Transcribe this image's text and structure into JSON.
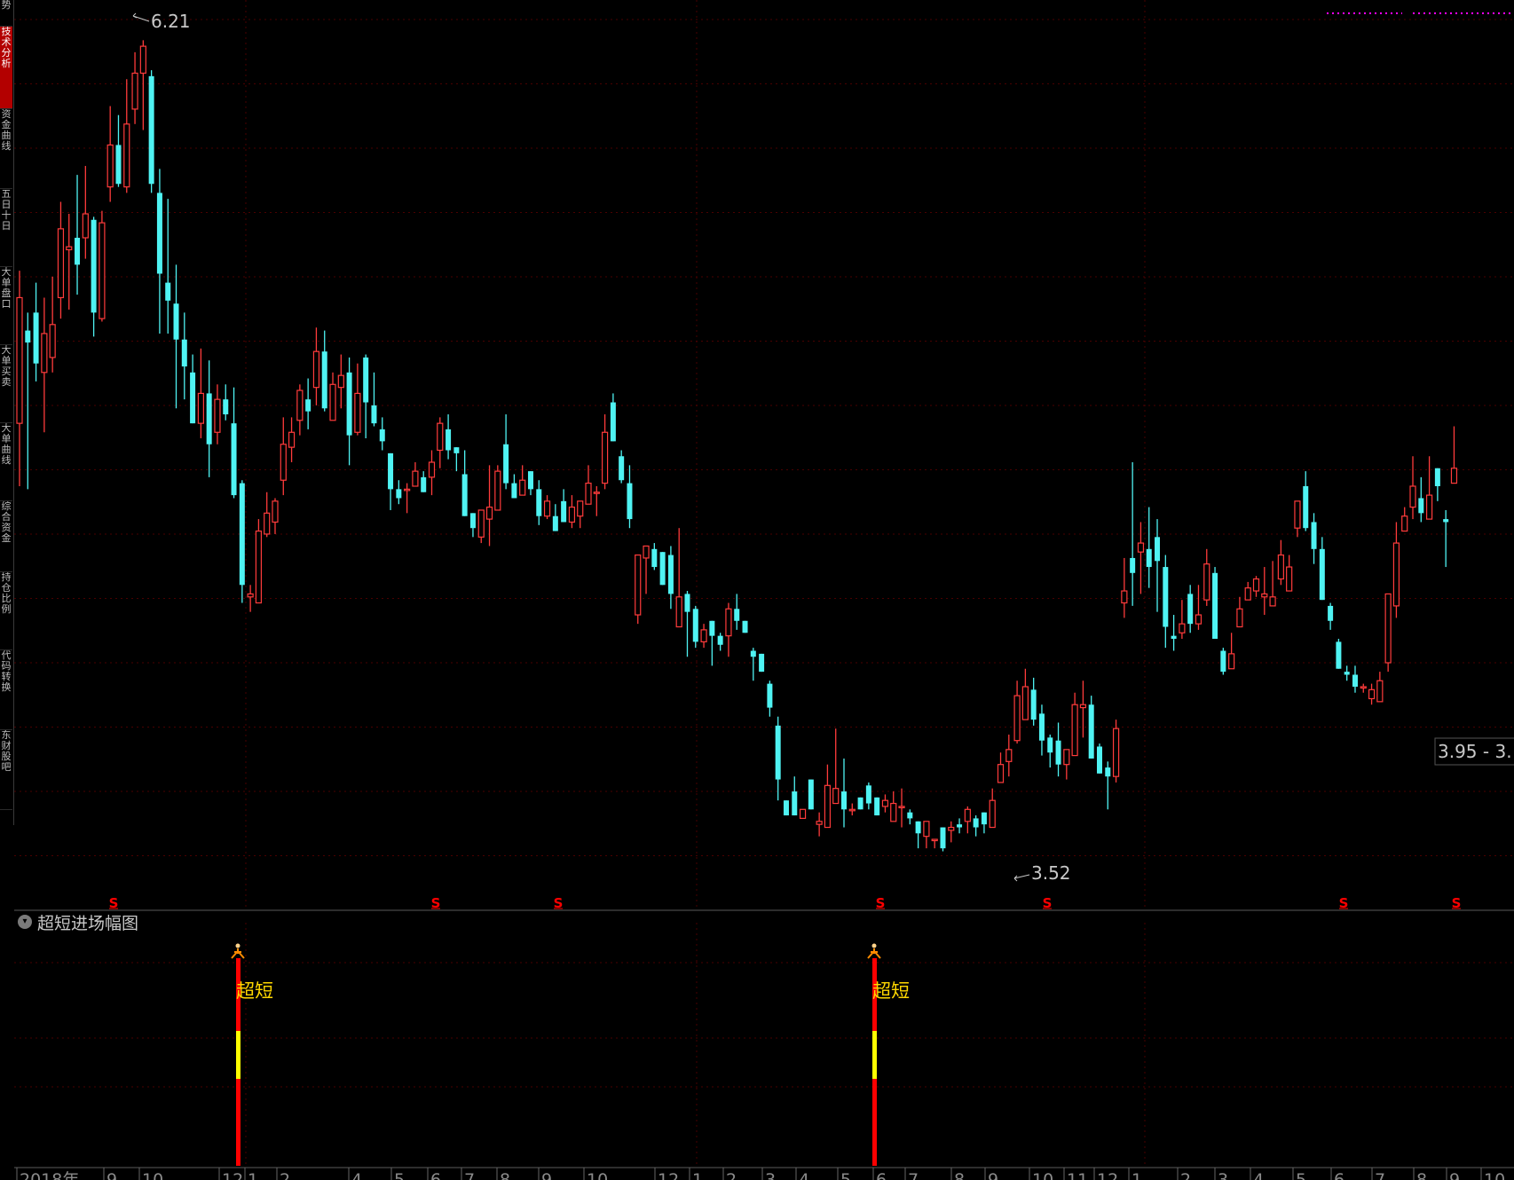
{
  "sidebar": {
    "tabs": [
      {
        "label": "势",
        "active": false
      },
      {
        "label": "技术分析",
        "active": true
      },
      {
        "label": "资金曲线",
        "active": false
      },
      {
        "label": "五日十日",
        "active": false
      },
      {
        "label": "大单盘口",
        "active": false
      },
      {
        "label": "大单买卖",
        "active": false
      },
      {
        "label": "大单曲线",
        "active": false
      },
      {
        "label": "综合资金",
        "active": false
      },
      {
        "label": "持仓比例",
        "active": false
      },
      {
        "label": "代码转换",
        "active": false
      },
      {
        "label": "东财股吧",
        "active": false
      }
    ]
  },
  "indicator_panel": {
    "title": "超短进场幅图"
  },
  "colors": {
    "up": "#ff3b3b",
    "down": "#4ff3f3",
    "grid": "#4a0000",
    "separator": "#5a5a5a",
    "signal_text": "#ffd700",
    "signal_bar": "#ff0000",
    "signal_mid": "#ffff00",
    "marker": "#ff0000",
    "magenta": "#ff00ff"
  },
  "chart_data": {
    "type": "candlestick",
    "title": "",
    "xlabel": "",
    "ylabel": "",
    "ylim": [
      3.4,
      6.32
    ],
    "grid": true,
    "x_axis_labels": [
      "2018年",
      "9",
      "10",
      "12",
      "1",
      "2",
      "4",
      "5",
      "6",
      "7",
      "8",
      "9",
      "10",
      "12",
      "1",
      "2",
      "3",
      "4",
      "5",
      "6",
      "7",
      "8",
      "9",
      "10",
      "11",
      "12",
      "1",
      "2",
      "3",
      "4",
      "5",
      "6",
      "7",
      "8",
      "9",
      "10"
    ],
    "candles": [
      [
        4.95,
        5.37,
        5.46,
        4.74
      ],
      [
        5.26,
        5.22,
        5.32,
        4.73
      ],
      [
        5.32,
        5.15,
        5.42,
        5.09
      ],
      [
        5.12,
        5.25,
        5.37,
        4.92
      ],
      [
        5.17,
        5.28,
        5.44,
        5.12
      ],
      [
        5.37,
        5.6,
        5.69,
        5.3
      ],
      [
        5.53,
        5.54,
        5.65,
        5.33
      ],
      [
        5.57,
        5.48,
        5.78,
        5.38
      ],
      [
        5.57,
        5.65,
        5.81,
        5.5
      ],
      [
        5.63,
        5.32,
        5.64,
        5.24
      ],
      [
        5.3,
        5.62,
        5.66,
        5.29
      ],
      [
        5.74,
        5.88,
        6.01,
        5.69
      ],
      [
        5.88,
        5.75,
        5.98,
        5.74
      ],
      [
        5.74,
        5.95,
        6.1,
        5.72
      ],
      [
        6.0,
        6.12,
        6.19,
        5.95
      ],
      [
        6.12,
        6.21,
        6.23,
        5.93
      ],
      [
        6.11,
        5.75,
        6.13,
        5.72
      ],
      [
        5.72,
        5.45,
        5.8,
        5.25
      ],
      [
        5.42,
        5.36,
        5.7,
        5.25
      ],
      [
        5.35,
        5.23,
        5.48,
        5.0
      ],
      [
        5.23,
        5.14,
        5.32,
        5.03
      ],
      [
        5.12,
        4.95,
        5.18,
        4.95
      ],
      [
        4.95,
        5.05,
        5.2,
        4.9
      ],
      [
        5.05,
        4.88,
        5.16,
        4.77
      ],
      [
        4.92,
        5.03,
        5.08,
        4.88
      ],
      [
        5.03,
        4.98,
        5.08,
        4.96
      ],
      [
        4.95,
        4.71,
        5.07,
        4.7
      ],
      [
        4.75,
        4.41,
        4.76,
        4.35
      ],
      [
        4.37,
        4.38,
        4.41,
        4.32
      ],
      [
        4.35,
        4.59,
        4.63,
        4.39
      ],
      [
        4.58,
        4.65,
        4.72,
        4.57
      ],
      [
        4.62,
        4.69,
        4.7,
        4.58
      ],
      [
        4.76,
        4.88,
        4.97,
        4.71
      ],
      [
        4.87,
        4.92,
        4.97,
        4.82
      ],
      [
        4.96,
        5.06,
        5.08,
        4.91
      ],
      [
        5.03,
        4.99,
        5.1,
        4.93
      ],
      [
        5.07,
        5.19,
        5.27,
        5.01
      ],
      [
        5.19,
        5.0,
        5.26,
        4.99
      ],
      [
        4.96,
        5.08,
        5.12,
        5.05
      ],
      [
        5.07,
        5.11,
        5.18,
        5.0
      ],
      [
        5.12,
        4.91,
        5.17,
        4.81
      ],
      [
        4.92,
        5.05,
        5.15,
        4.91
      ],
      [
        5.17,
        5.02,
        5.18,
        4.9
      ],
      [
        5.01,
        4.95,
        5.12,
        4.94
      ],
      [
        4.93,
        4.89,
        4.97,
        4.86
      ],
      [
        4.85,
        4.73,
        4.83,
        4.66
      ],
      [
        4.73,
        4.7,
        4.76,
        4.68
      ],
      [
        4.73,
        4.73,
        4.75,
        4.65
      ],
      [
        4.74,
        4.79,
        4.82,
        4.76
      ],
      [
        4.77,
        4.72,
        4.79,
        4.73
      ],
      [
        4.77,
        4.82,
        4.86,
        4.71
      ],
      [
        4.86,
        4.95,
        4.97,
        4.8
      ],
      [
        4.93,
        4.86,
        4.98,
        4.83
      ],
      [
        4.87,
        4.85,
        4.83,
        4.79
      ],
      [
        4.78,
        4.64,
        4.86,
        4.77
      ],
      [
        4.65,
        4.6,
        4.6,
        4.57
      ],
      [
        4.57,
        4.66,
        4.65,
        4.55
      ],
      [
        4.63,
        4.67,
        4.81,
        4.54
      ],
      [
        4.66,
        4.79,
        4.81,
        4.77
      ],
      [
        4.88,
        4.75,
        4.98,
        4.73
      ],
      [
        4.75,
        4.7,
        4.78,
        4.7
      ],
      [
        4.71,
        4.76,
        4.81,
        4.75
      ],
      [
        4.79,
        4.73,
        4.79,
        4.71
      ],
      [
        4.73,
        4.64,
        4.76,
        4.61
      ],
      [
        4.64,
        4.69,
        4.71,
        4.63
      ],
      [
        4.64,
        4.59,
        4.68,
        4.61
      ],
      [
        4.69,
        4.62,
        4.73,
        4.67
      ],
      [
        4.62,
        4.67,
        4.71,
        4.6
      ],
      [
        4.64,
        4.69,
        4.69,
        4.6
      ],
      [
        4.68,
        4.75,
        4.81,
        4.74
      ],
      [
        4.72,
        4.72,
        4.74,
        4.64
      ],
      [
        4.75,
        4.92,
        4.98,
        4.73
      ],
      [
        5.02,
        4.89,
        5.05,
        4.96
      ],
      [
        4.84,
        4.76,
        4.86,
        4.75
      ],
      [
        4.75,
        4.63,
        4.81,
        4.6
      ],
      [
        4.31,
        4.51,
        4.51,
        4.28
      ],
      [
        4.5,
        4.54,
        4.52,
        4.38
      ],
      [
        4.53,
        4.47,
        4.55,
        4.46
      ],
      [
        4.52,
        4.41,
        4.52,
        4.43
      ],
      [
        4.51,
        4.38,
        4.54,
        4.33
      ],
      [
        4.27,
        4.37,
        4.6,
        4.33
      ],
      [
        4.38,
        4.32,
        4.39,
        4.17
      ],
      [
        4.33,
        4.22,
        4.34,
        4.2
      ],
      [
        4.22,
        4.26,
        4.28,
        4.2
      ],
      [
        4.29,
        4.24,
        4.27,
        4.14
      ],
      [
        4.24,
        4.21,
        4.25,
        4.19
      ],
      [
        4.24,
        4.33,
        4.35,
        4.17
      ],
      [
        4.33,
        4.29,
        4.38,
        4.26
      ],
      [
        4.29,
        4.25,
        4.29,
        4.25
      ],
      [
        4.19,
        4.17,
        4.2,
        4.09
      ],
      [
        4.18,
        4.12,
        4.16,
        4.15
      ],
      [
        4.08,
        4.0,
        4.09,
        3.97
      ],
      [
        3.94,
        3.76,
        3.97,
        3.69
      ],
      [
        3.69,
        3.64,
        3.69,
        3.66
      ],
      [
        3.72,
        3.64,
        3.77,
        3.65
      ],
      [
        3.63,
        3.66,
        3.66,
        3.64
      ],
      [
        3.76,
        3.66,
        3.71,
        3.67
      ],
      [
        3.61,
        3.62,
        3.65,
        3.57
      ],
      [
        3.6,
        3.74,
        3.81,
        3.6
      ],
      [
        3.68,
        3.73,
        3.93,
        3.69
      ],
      [
        3.72,
        3.66,
        3.83,
        3.6
      ],
      [
        3.66,
        3.66,
        3.68,
        3.64
      ],
      [
        3.7,
        3.66,
        3.67,
        3.7
      ],
      [
        3.74,
        3.68,
        3.75,
        3.66
      ],
      [
        3.7,
        3.64,
        3.7,
        3.66
      ],
      [
        3.67,
        3.69,
        3.71,
        3.65
      ],
      [
        3.62,
        3.68,
        3.72,
        3.64
      ],
      [
        3.67,
        3.67,
        3.73,
        3.6
      ],
      [
        3.65,
        3.63,
        3.66,
        3.61
      ],
      [
        3.62,
        3.58,
        3.62,
        3.53
      ],
      [
        3.57,
        3.62,
        3.61,
        3.53
      ],
      [
        3.56,
        3.56,
        3.56,
        3.53
      ],
      [
        3.6,
        3.53,
        3.58,
        3.52
      ],
      [
        3.59,
        3.6,
        3.62,
        3.55
      ],
      [
        3.61,
        3.6,
        3.63,
        3.58
      ],
      [
        3.62,
        3.66,
        3.67,
        3.58
      ],
      [
        3.63,
        3.6,
        3.64,
        3.57
      ],
      [
        3.65,
        3.61,
        3.63,
        3.58
      ],
      [
        3.6,
        3.69,
        3.73,
        3.62
      ],
      [
        3.75,
        3.81,
        3.85,
        3.75
      ],
      [
        3.82,
        3.86,
        3.91,
        3.77
      ],
      [
        3.89,
        4.04,
        4.09,
        3.88
      ],
      [
        3.96,
        4.07,
        4.13,
        3.96
      ],
      [
        4.06,
        3.96,
        4.1,
        3.94
      ],
      [
        3.98,
        3.89,
        4.01,
        3.84
      ],
      [
        3.9,
        3.85,
        3.91,
        3.8
      ],
      [
        3.89,
        3.81,
        3.95,
        3.77
      ],
      [
        3.81,
        3.86,
        3.84,
        3.76
      ],
      [
        3.84,
        4.01,
        4.05,
        3.84
      ],
      [
        4.0,
        4.01,
        4.09,
        3.9
      ],
      [
        4.01,
        3.83,
        4.04,
        3.85
      ],
      [
        3.87,
        3.78,
        3.88,
        3.78
      ],
      [
        3.8,
        3.77,
        3.82,
        3.66
      ],
      [
        3.77,
        3.93,
        3.96,
        3.75
      ],
      [
        4.35,
        4.39,
        4.5,
        4.3
      ],
      [
        4.5,
        4.45,
        4.82,
        4.34
      ],
      [
        4.52,
        4.55,
        4.62,
        4.38
      ],
      [
        4.53,
        4.47,
        4.67,
        4.4
      ],
      [
        4.57,
        4.49,
        4.63,
        4.32
      ],
      [
        4.47,
        4.27,
        4.51,
        4.2
      ],
      [
        4.24,
        4.23,
        4.31,
        4.19
      ],
      [
        4.25,
        4.28,
        4.36,
        4.23
      ],
      [
        4.38,
        4.28,
        4.41,
        4.25
      ],
      [
        4.28,
        4.31,
        4.41,
        4.26
      ],
      [
        4.36,
        4.48,
        4.53,
        4.34
      ],
      [
        4.45,
        4.23,
        4.47,
        4.23
      ],
      [
        4.19,
        4.12,
        4.2,
        4.11
      ],
      [
        4.13,
        4.18,
        4.25,
        4.13
      ],
      [
        4.27,
        4.33,
        4.37,
        4.3
      ],
      [
        4.36,
        4.4,
        4.42,
        4.38
      ],
      [
        4.39,
        4.43,
        4.44,
        4.37
      ],
      [
        4.37,
        4.38,
        4.47,
        4.31
      ],
      [
        4.34,
        4.37,
        4.49,
        4.36
      ],
      [
        4.43,
        4.51,
        4.56,
        4.41
      ],
      [
        4.39,
        4.47,
        4.51,
        4.4
      ],
      [
        4.6,
        4.69,
        4.64,
        4.57
      ],
      [
        4.74,
        4.6,
        4.79,
        4.59
      ],
      [
        4.62,
        4.53,
        4.65,
        4.48
      ],
      [
        4.53,
        4.36,
        4.57,
        4.37
      ],
      [
        4.34,
        4.29,
        4.35,
        4.26
      ],
      [
        4.22,
        4.13,
        4.23,
        4.13
      ],
      [
        4.12,
        4.11,
        4.14,
        4.09
      ],
      [
        4.11,
        4.07,
        4.14,
        4.05
      ],
      [
        4.07,
        4.07,
        4.08,
        4.05
      ],
      [
        4.03,
        4.06,
        4.08,
        4.01
      ],
      [
        4.02,
        4.09,
        4.12,
        4.03
      ],
      [
        4.15,
        4.38,
        4.37,
        4.12
      ],
      [
        4.34,
        4.55,
        4.62,
        4.3
      ],
      [
        4.59,
        4.64,
        4.67,
        4.6
      ],
      [
        4.67,
        4.74,
        4.84,
        4.63
      ],
      [
        4.7,
        4.65,
        4.77,
        4.62
      ],
      [
        4.63,
        4.71,
        4.84,
        4.64
      ],
      [
        4.8,
        4.74,
        4.76,
        4.69
      ],
      [
        4.63,
        4.62,
        4.66,
        4.47
      ],
      [
        4.75,
        4.8,
        4.94,
        4.77
      ]
    ],
    "annotations": {
      "high_label": "6.21",
      "low_label": "3.52",
      "range_label": "3.95 - 3.",
      "s_marker": "S",
      "signal_text": "超短",
      "signal_icon": "rocket-person-icon"
    }
  }
}
